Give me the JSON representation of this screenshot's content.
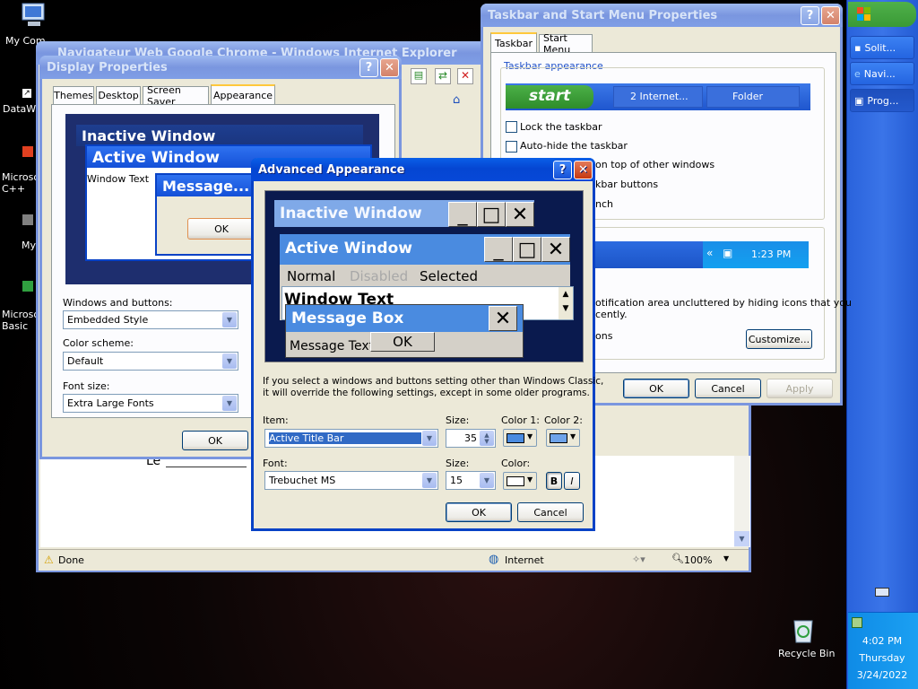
{
  "desktop": {
    "icons": [
      {
        "label": "My Com",
        "icon": "computer-icon"
      },
      {
        "label": "DataWa",
        "icon": "shortcut-icon"
      },
      {
        "label": "Microsof C++",
        "icon": "shortcut-icon"
      },
      {
        "label": "My",
        "icon": "shortcut-icon"
      },
      {
        "label": "Microso Basic",
        "icon": "shortcut-icon"
      }
    ],
    "recycle_bin": "Recycle Bin"
  },
  "taskbar": {
    "items": [
      "Solit...",
      "Navi...",
      "Prog..."
    ],
    "clock": {
      "time": "4:02 PM",
      "day": "Thursday",
      "date": "3/24/2022"
    }
  },
  "ie_window": {
    "title": "Navigateur Web Google Chrome - Windows Internet Explorer",
    "content_text": "Le",
    "status": {
      "done": "Done",
      "zone": "Internet",
      "zoom": "100%"
    }
  },
  "display_props": {
    "title": "Display Properties",
    "tabs": [
      "Themes",
      "Desktop",
      "Screen Saver",
      "Appearance"
    ],
    "preview": {
      "inactive": "Inactive Window",
      "active": "Active Window",
      "window_text": "Window Text",
      "message": "Message...",
      "ok": "OK"
    },
    "windows_buttons_label": "Windows and buttons:",
    "windows_buttons_value": "Embedded Style",
    "color_scheme_label": "Color scheme:",
    "color_scheme_value": "Default",
    "font_size_label": "Font size:",
    "font_size_value": "Extra Large Fonts",
    "ok": "OK"
  },
  "taskbar_props": {
    "title": "Taskbar and Start Menu Properties",
    "tabs": [
      "Taskbar",
      "Start Menu"
    ],
    "group_label": "Taskbar appearance",
    "preview": {
      "start": "start",
      "ie_btn": "2 Internet...",
      "folder": "Folder",
      "tray_time": "1:23 PM"
    },
    "options": [
      "Lock the taskbar",
      "Auto-hide the taskbar",
      "on top of other windows",
      "kbar buttons",
      "nch"
    ],
    "notification_text1": "otification area uncluttered by hiding icons that you",
    "notification_text2": "cently.",
    "hide_text": "ons",
    "customize": "Customize...",
    "ok": "OK",
    "cancel": "Cancel",
    "apply": "Apply"
  },
  "advanced": {
    "title": "Advanced Appearance",
    "preview": {
      "inactive": "Inactive Window",
      "active": "Active Window",
      "menu": [
        "Normal",
        "Disabled",
        "Selected"
      ],
      "window_text": "Window Text",
      "message_box": "Message Box",
      "message_text": "Message Text",
      "ok": "OK"
    },
    "info_line1": "If you select a windows and buttons setting other than Windows Classic,",
    "info_line2": "it will override the following settings, except in some older programs.",
    "item_label": "Item:",
    "item_value": "Active Title Bar",
    "size_label": "Size:",
    "item_size": "35",
    "color1_label": "Color 1:",
    "color2_label": "Color 2:",
    "font_label": "Font:",
    "font_value": "Trebuchet MS",
    "font_size_label": "Size:",
    "font_size": "15",
    "color_label": "Color:",
    "bold": "B",
    "italic": "I",
    "ok": "OK",
    "cancel": "Cancel",
    "colors": {
      "color1": "#4A8BE0",
      "color2": "#6EA3EA",
      "font_color": "#FFFFFF"
    }
  }
}
